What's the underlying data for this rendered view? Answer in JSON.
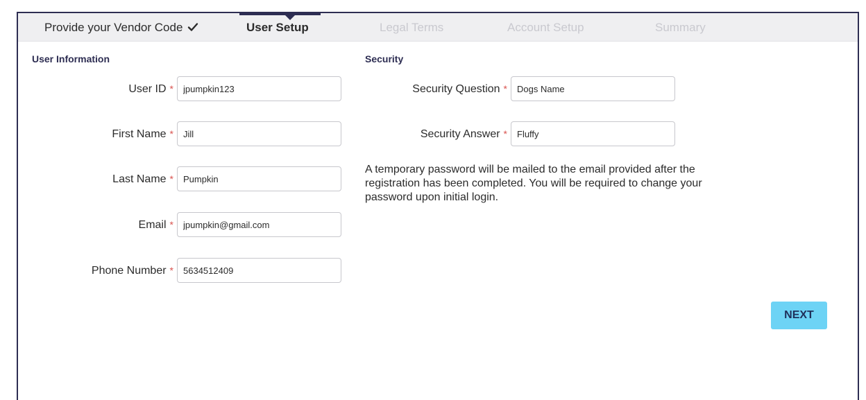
{
  "steps": [
    {
      "label": "Provide your Vendor Code",
      "state": "done",
      "icon": "check-icon"
    },
    {
      "label": "User Setup",
      "state": "active"
    },
    {
      "label": "Legal Terms",
      "state": "pending"
    },
    {
      "label": "Account Setup",
      "state": "pending"
    },
    {
      "label": "Summary",
      "state": "pending"
    }
  ],
  "user_info": {
    "title": "User Information",
    "fields": [
      {
        "label": "User ID",
        "value": "jpumpkin123"
      },
      {
        "label": "First Name",
        "value": "Jill"
      },
      {
        "label": "Last Name",
        "value": "Pumpkin"
      },
      {
        "label": "Email",
        "value": "jpumpkin@gmail.com"
      },
      {
        "label": "Phone Number",
        "value": "5634512409"
      }
    ]
  },
  "security": {
    "title": "Security",
    "fields": [
      {
        "label": "Security Question",
        "value": "Dogs Name"
      },
      {
        "label": "Security Answer",
        "value": "Fluffy"
      }
    ],
    "note": "A temporary password will be mailed to the email provided after the registration has been completed. You will be required to change your password upon initial login."
  },
  "required_marker": "*",
  "actions": {
    "next_label": "NEXT"
  },
  "colors": {
    "frame": "#2d2d52",
    "accent_button": "#6dd3f5",
    "required": "#d9534f",
    "stepbar_bg": "#efeff1",
    "pending_step": "#c9c9cf"
  }
}
